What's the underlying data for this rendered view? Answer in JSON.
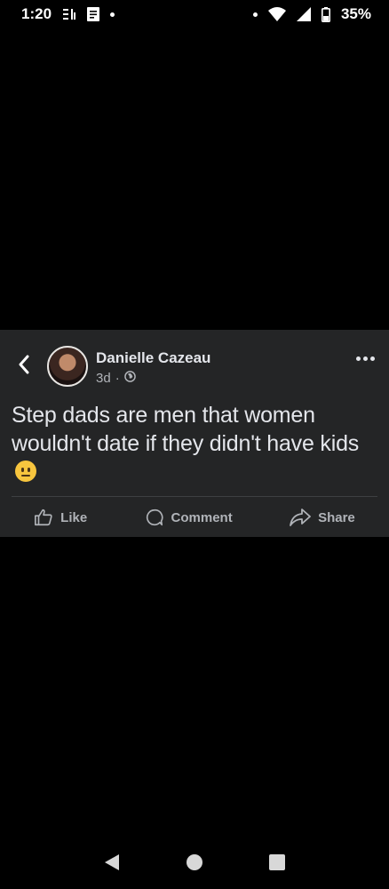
{
  "status_bar": {
    "time": "1:20",
    "battery": "35%",
    "icons": [
      "notification-icon",
      "document-icon",
      "dot-icon",
      "dot-icon",
      "wifi-icon",
      "signal-icon",
      "battery-icon"
    ]
  },
  "post": {
    "author": "Danielle Cazeau",
    "time": "3d",
    "separator": "·",
    "privacy_icon": "globe-icon",
    "text": "Step dads are men that women wouldn't date if they didn't have kids",
    "emoji": "neutral-face-emoji",
    "actions": {
      "like": "Like",
      "comment": "Comment",
      "share": "Share"
    }
  },
  "colors": {
    "card_bg": "#242526",
    "text_primary": "#e4e6eb",
    "text_secondary": "#b0b3b8"
  }
}
